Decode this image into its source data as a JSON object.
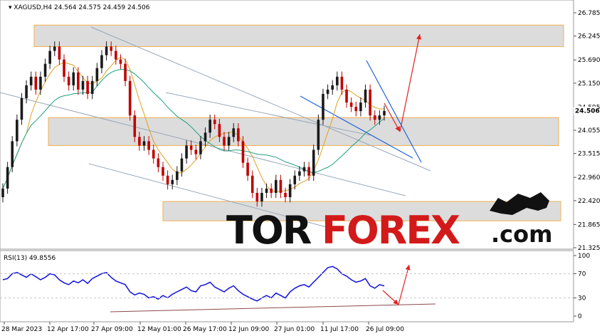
{
  "chart_data": [
    {
      "type": "candlestick",
      "symbol_label": "XAGUSD,H4",
      "ohlc_label": "24.564 24.575 24.459 24.506",
      "last_price_label": "24.506",
      "y_ticks": [
        "26.785",
        "26.245",
        "25.690",
        "25.150",
        "24.595",
        "24.055",
        "23.515",
        "22.960",
        "22.420",
        "21.865",
        "21.325"
      ],
      "y_tick_values": [
        26.785,
        26.245,
        25.69,
        25.15,
        24.595,
        24.055,
        23.515,
        22.96,
        22.42,
        21.865,
        21.325
      ],
      "ylim": [
        21.325,
        26.785
      ],
      "x_tick_labels": [
        "28 Mar 2023",
        "12 Apr 17:00",
        "27 Apr 09:00",
        "12 May 01:00",
        "26 May 17:00",
        "12 Jun 09:00",
        "27 Jun 01:00",
        "11 Jul 17:00",
        "26 Jul 09:00"
      ],
      "series": [
        {
          "kind": "candles",
          "close": [
            22.7,
            23.2,
            23.8,
            24.3,
            24.8,
            25.1,
            25.3,
            25.0,
            25.3,
            25.6,
            25.9,
            26.0,
            25.7,
            25.3,
            25.1,
            25.4,
            25.0,
            25.2,
            24.9,
            25.2,
            25.5,
            25.8,
            26.0,
            25.9,
            25.7,
            25.6,
            25.2,
            24.4,
            23.9,
            23.7,
            23.8,
            23.6,
            23.4,
            23.2,
            23.0,
            22.8,
            22.9,
            23.1,
            23.4,
            23.7,
            23.6,
            23.5,
            23.8,
            24.0,
            24.3,
            24.2,
            23.9,
            23.7,
            23.9,
            24.1,
            23.8,
            23.3,
            23.0,
            22.6,
            22.4,
            22.6,
            22.7,
            22.6,
            22.9,
            22.6,
            22.5,
            22.8,
            23.0,
            23.1,
            23.2,
            23.0,
            23.6,
            24.3,
            24.9,
            25.0,
            25.1,
            25.3,
            25.0,
            24.7,
            24.6,
            24.5,
            24.7,
            25.0,
            24.4,
            24.3,
            24.4,
            24.506
          ]
        }
      ],
      "sr_zones": [
        [
          26.0,
          26.5
        ],
        [
          23.7,
          24.35
        ],
        [
          21.95,
          22.4
        ]
      ],
      "arrows": [
        "up",
        "down"
      ]
    },
    {
      "type": "line",
      "label": "RSI(13) 49.8556",
      "y_ticks": [
        "100",
        "70",
        "30",
        "0"
      ],
      "y_tick_values": [
        100,
        70,
        30,
        0
      ],
      "ylim": [
        0,
        100
      ],
      "series": [
        {
          "name": "RSI(13)",
          "values": [
            60,
            62,
            70,
            72,
            68,
            64,
            70,
            65,
            60,
            64,
            70,
            68,
            60,
            55,
            52,
            58,
            55,
            60,
            54,
            62,
            66,
            70,
            72,
            64,
            58,
            55,
            52,
            40,
            35,
            38,
            36,
            30,
            32,
            28,
            34,
            30,
            36,
            40,
            44,
            48,
            42,
            40,
            50,
            52,
            56,
            48,
            44,
            40,
            46,
            50,
            42,
            36,
            32,
            28,
            25,
            30,
            34,
            30,
            38,
            34,
            30,
            40,
            46,
            50,
            52,
            48,
            56,
            64,
            72,
            80,
            82,
            78,
            70,
            66,
            60,
            56,
            58,
            62,
            50,
            46,
            52,
            49.8556
          ]
        }
      ]
    }
  ],
  "watermark": "TORFOREX.com"
}
